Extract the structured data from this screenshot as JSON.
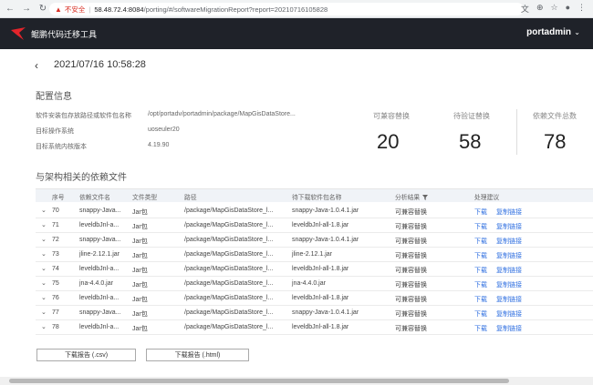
{
  "browser": {
    "back_icon": "back-arrow-icon",
    "forward_icon": "forward-arrow-icon",
    "reload_icon": "reload-icon",
    "security_label": "不安全",
    "url_host": "58.48.72.4:8084",
    "url_path": "/porting/#/softwareMigrationReport?report=20210716105828",
    "right_icons": [
      "translate-icon",
      "zoom-icon",
      "star-icon",
      "profile-icon",
      "menu-icon"
    ]
  },
  "app": {
    "title": "鲲鹏代码迁移工具",
    "user": "portadmin",
    "user_chevron": "⌄"
  },
  "report": {
    "timestamp": "2021/07/16 10:58:28"
  },
  "config": {
    "title": "配置信息",
    "items": [
      {
        "label": "软件安装包存放路径或软件包名称",
        "value": "/opt/portadv/portadmin/package/MapGisDataStore..."
      },
      {
        "label": "目标操作系统",
        "value": "uoseuler20"
      },
      {
        "label": "目标系统内核版本",
        "value": "4.19.90"
      }
    ]
  },
  "stats": [
    {
      "label": "可兼容替换",
      "value": "20"
    },
    {
      "label": "待验证替换",
      "value": "58"
    },
    {
      "label": "依赖文件总数",
      "value": "78"
    }
  ],
  "deps": {
    "title": "与架构相关的依赖文件",
    "headers": [
      "序号",
      "依赖文件名",
      "文件类型",
      "路径",
      "待下载软件包名称",
      "分析结果",
      "处理建议"
    ],
    "rows": [
      {
        "no": "70",
        "name": "snappy-Java...",
        "type": "Jar包",
        "path": "/package/MapGisDataStore_l...",
        "pkg": "snappy-Java-1.0.4.1.jar",
        "result": "可兼容替换",
        "action1": "下载",
        "action2": "复制链接"
      },
      {
        "no": "71",
        "name": "leveldbJnl-a...",
        "type": "Jar包",
        "path": "/package/MapGisDataStore_l...",
        "pkg": "leveldbJnl-all-1.8.jar",
        "result": "可兼容替换",
        "action1": "下载",
        "action2": "复制链接"
      },
      {
        "no": "72",
        "name": "snappy-Java...",
        "type": "Jar包",
        "path": "/package/MapGisDataStore_l...",
        "pkg": "snappy-Java-1.0.4.1.jar",
        "result": "可兼容替换",
        "action1": "下载",
        "action2": "复制链接"
      },
      {
        "no": "73",
        "name": "jline-2.12.1.jar",
        "type": "Jar包",
        "path": "/package/MapGisDataStore_l...",
        "pkg": "jline-2.12.1.jar",
        "result": "可兼容替换",
        "action1": "下载",
        "action2": "复制链接"
      },
      {
        "no": "74",
        "name": "leveldbJnl-a...",
        "type": "Jar包",
        "path": "/package/MapGisDataStore_l...",
        "pkg": "leveldbJnl-all-1.8.jar",
        "result": "可兼容替换",
        "action1": "下载",
        "action2": "复制链接"
      },
      {
        "no": "75",
        "name": "jna-4.4.0.jar",
        "type": "Jar包",
        "path": "/package/MapGisDataStore_l...",
        "pkg": "jna-4.4.0.jar",
        "result": "可兼容替换",
        "action1": "下载",
        "action2": "复制链接"
      },
      {
        "no": "76",
        "name": "leveldbJnl-a...",
        "type": "Jar包",
        "path": "/package/MapGisDataStore_l...",
        "pkg": "leveldbJnl-all-1.8.jar",
        "result": "可兼容替换",
        "action1": "下载",
        "action2": "复制链接"
      },
      {
        "no": "77",
        "name": "snappy-Java...",
        "type": "Jar包",
        "path": "/package/MapGisDataStore_l...",
        "pkg": "snappy-Java-1.0.4.1.jar",
        "result": "可兼容替换",
        "action1": "下载",
        "action2": "复制链接"
      },
      {
        "no": "78",
        "name": "leveldbJnl-a...",
        "type": "Jar包",
        "path": "/package/MapGisDataStore_l...",
        "pkg": "leveldbJnl-all-1.8.jar",
        "result": "可兼容替换",
        "action1": "下载",
        "action2": "复制链接"
      }
    ]
  },
  "buttons": {
    "csv": "下载报告 (.csv)",
    "html": "下载报告 (.html)"
  }
}
